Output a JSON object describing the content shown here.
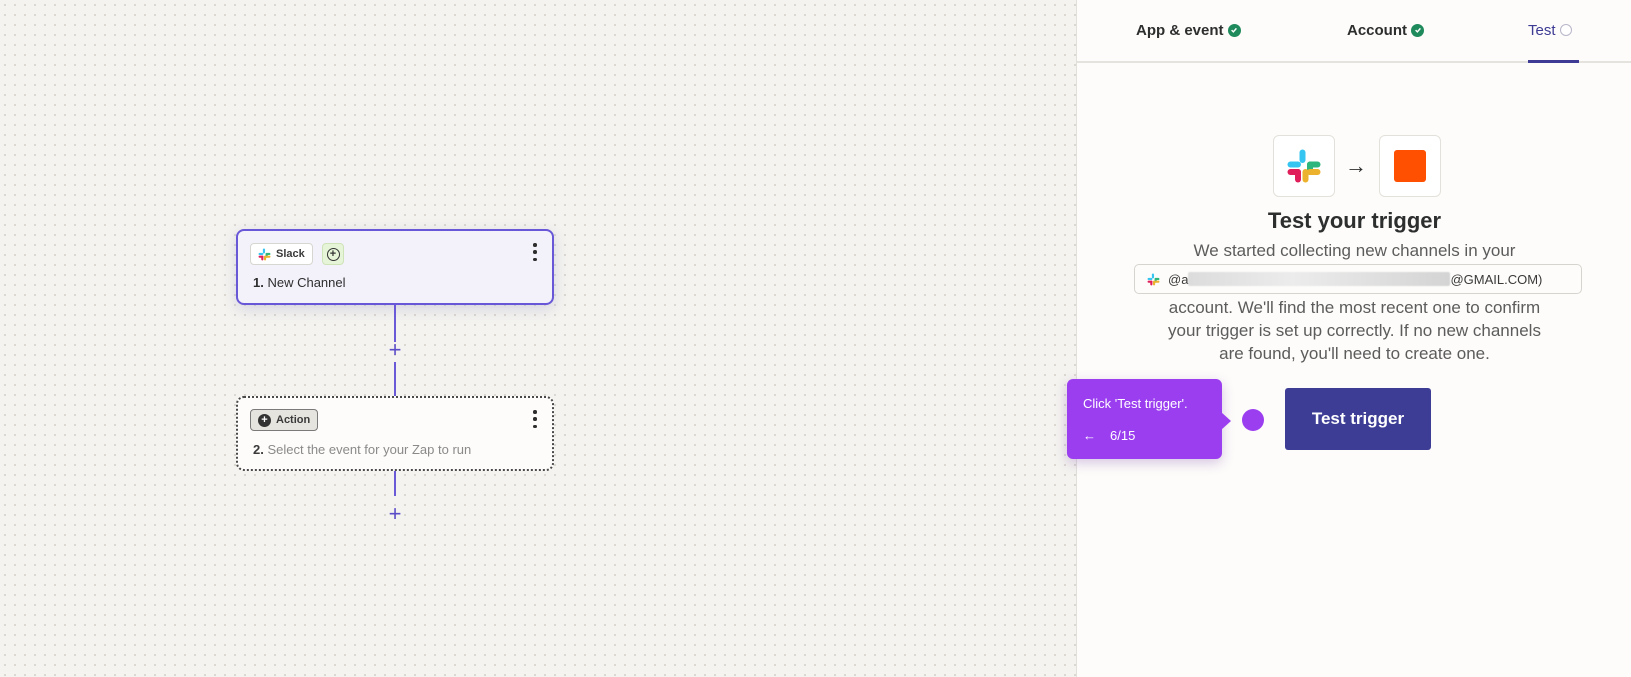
{
  "canvas": {
    "steps": [
      {
        "app_label": "Slack",
        "number": "1.",
        "title": "New Channel"
      },
      {
        "app_label": "Action",
        "number": "2.",
        "title": "Select the event for your Zap to run"
      }
    ],
    "add_symbol": "+"
  },
  "panel": {
    "tabs": [
      {
        "label": "App & event",
        "status": "complete"
      },
      {
        "label": "Account",
        "status": "complete"
      },
      {
        "label": "Test",
        "status": "current"
      }
    ],
    "arrow": "→",
    "heading": "Test your trigger",
    "desc_line1": "We started collecting new channels in your",
    "account_prefix": "@a",
    "account_suffix": "@GMAIL.COM)",
    "desc_line2": "account. We'll find the most recent one to confirm",
    "desc_line3": "your trigger is set up correctly. If no new channels",
    "desc_line4": "are found, you'll need to create one.",
    "button_label": "Test trigger"
  },
  "tooltip": {
    "text": "Click 'Test trigger'.",
    "back_arrow": "←",
    "progress": "6/15"
  },
  "colors": {
    "accent": "#3d3d96",
    "selected_border": "#6857d6",
    "tooltip": "#9b3ef0",
    "zapier_orange": "#ff4f00",
    "check_green": "#1f8a5b"
  }
}
